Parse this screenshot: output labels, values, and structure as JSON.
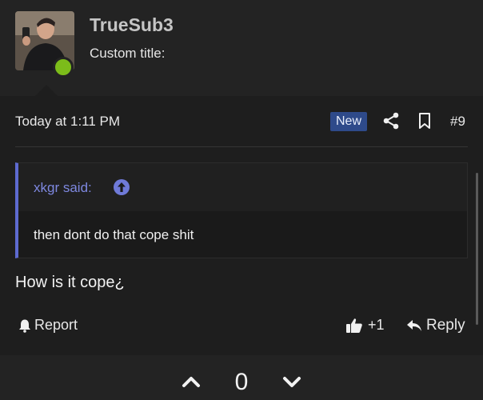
{
  "user": {
    "username": "TrueSub3",
    "custom_title": "Custom title:",
    "online": true,
    "online_color": "#7cbc1a"
  },
  "post": {
    "date": "Today at 1:11 PM",
    "new_badge": "New",
    "number": "#9",
    "icons": [
      "share-icon",
      "bookmark-icon"
    ],
    "quote": {
      "author_label": "xkgr said:",
      "icon": "arrow-up-circle-icon",
      "text": "then dont do that cope shit"
    },
    "text": "How is it cope¿"
  },
  "actions": {
    "report_label": "Report",
    "like_label": "+1",
    "reply_label": "Reply"
  },
  "vote": {
    "count": "0"
  },
  "colors": {
    "background": "#1e1e1e",
    "accent": "#5d6ad0",
    "new_badge": "#2e4a8a"
  }
}
